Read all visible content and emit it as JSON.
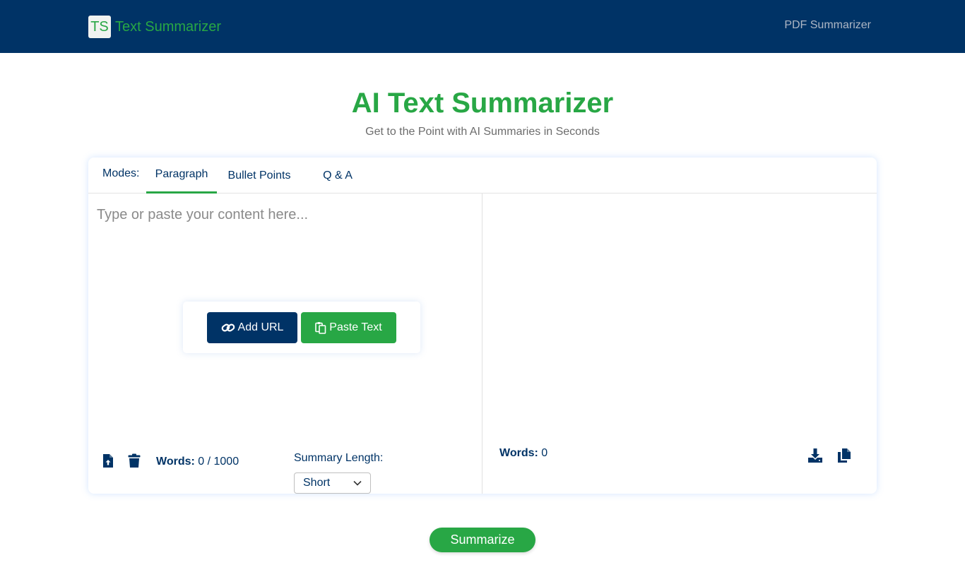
{
  "header": {
    "logo_text": "TS",
    "brand_name": "Text Summarizer",
    "nav_link": "PDF Summarizer"
  },
  "hero": {
    "title": "AI Text Summarizer",
    "subtitle": "Get to the Point with AI Summaries in Seconds"
  },
  "modes": {
    "label": "Modes:",
    "tabs": [
      {
        "label": "Paragraph",
        "active": true
      },
      {
        "label": "Bullet Points",
        "active": false
      },
      {
        "label": "Q & A",
        "active": false
      }
    ]
  },
  "input": {
    "placeholder": "Type or paste your content here...",
    "value": ""
  },
  "actions": {
    "add_url": "Add URL",
    "paste_text": "Paste Text"
  },
  "input_footer": {
    "words_label": "Words:",
    "words_value": "0 / 1000",
    "upload_icon": "file-upload-icon",
    "delete_icon": "trash-icon"
  },
  "summary_length": {
    "label": "Summary Length:",
    "selected": "Short"
  },
  "output_footer": {
    "words_label": "Words:",
    "words_value": "0",
    "download_icon": "download-icon",
    "copy_icon": "copy-icon"
  },
  "summarize_label": "Summarize",
  "colors": {
    "navy": "#003366",
    "green": "#28a745"
  }
}
